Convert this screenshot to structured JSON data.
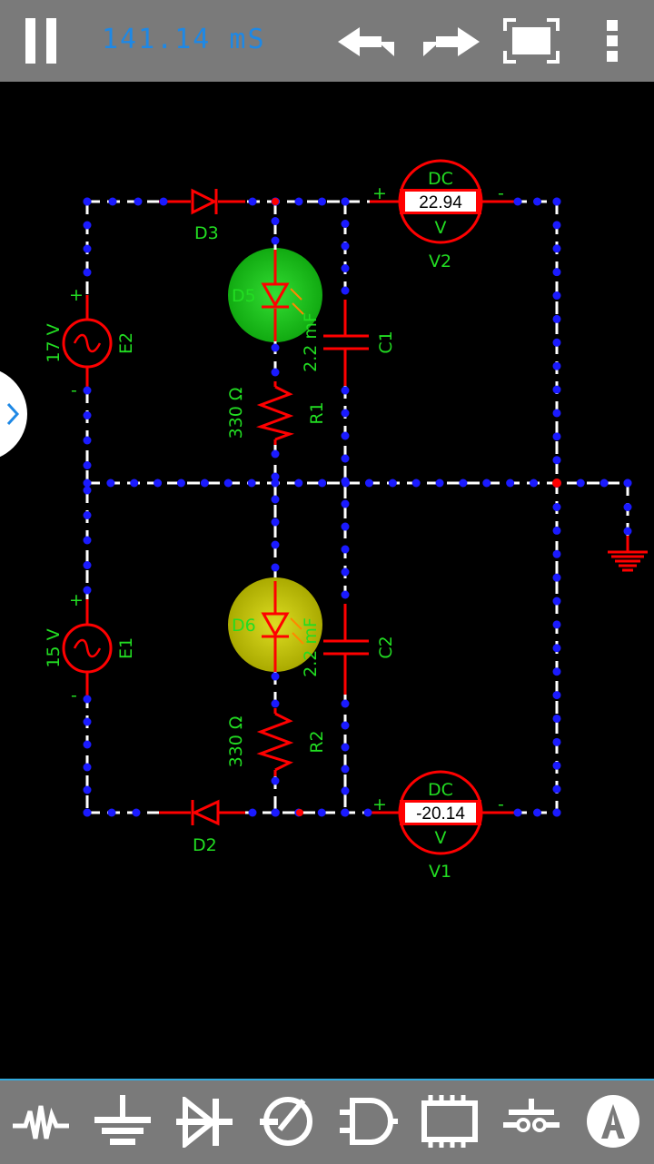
{
  "toolbar": {
    "elapsed_time": "141.14 mS",
    "pause_icon": "pause-icon",
    "undo_icon": "undo-icon",
    "redo_icon": "redo-icon",
    "fit_icon": "fit-screen-icon",
    "menu_icon": "overflow-menu-icon"
  },
  "components": {
    "D3": "D3",
    "D2": "D2",
    "D5": "D5",
    "D6": "D6",
    "E2": "E2",
    "E2_value": "17 V",
    "E1": "E1",
    "E1_value": "15 V",
    "R1": "R1",
    "R1_value": "330 Ω",
    "R2": "R2",
    "R2_value": "330 Ω",
    "C1": "C1",
    "C1_value": "2.2 mF",
    "C2": "C2",
    "C2_value": "2.2 mF",
    "V2": "V2",
    "V1": "V1",
    "V2_mode": "DC",
    "V1_mode": "DC",
    "V2_reading": "22.94",
    "V1_reading": "-20.14",
    "V2_unit": "V",
    "V1_unit": "V",
    "plus": "+",
    "minus": "-"
  },
  "bottom_toolbar": [
    {
      "icon": "resistor-category-icon"
    },
    {
      "icon": "ground-category-icon"
    },
    {
      "icon": "diode-category-icon"
    },
    {
      "icon": "transistor-category-icon"
    },
    {
      "icon": "logic-gate-category-icon"
    },
    {
      "icon": "ic-chip-category-icon"
    },
    {
      "icon": "switch-category-icon"
    },
    {
      "icon": "meter-category-icon"
    }
  ],
  "colors": {
    "wire": "#ffffff",
    "component": "#ff0000",
    "node": "#1a1aff",
    "label": "#22dd22",
    "led_green": "#22cc22",
    "led_yellow": "#cccc00",
    "toolbar": "#7a7a7a",
    "accent": "#1e88e5"
  }
}
